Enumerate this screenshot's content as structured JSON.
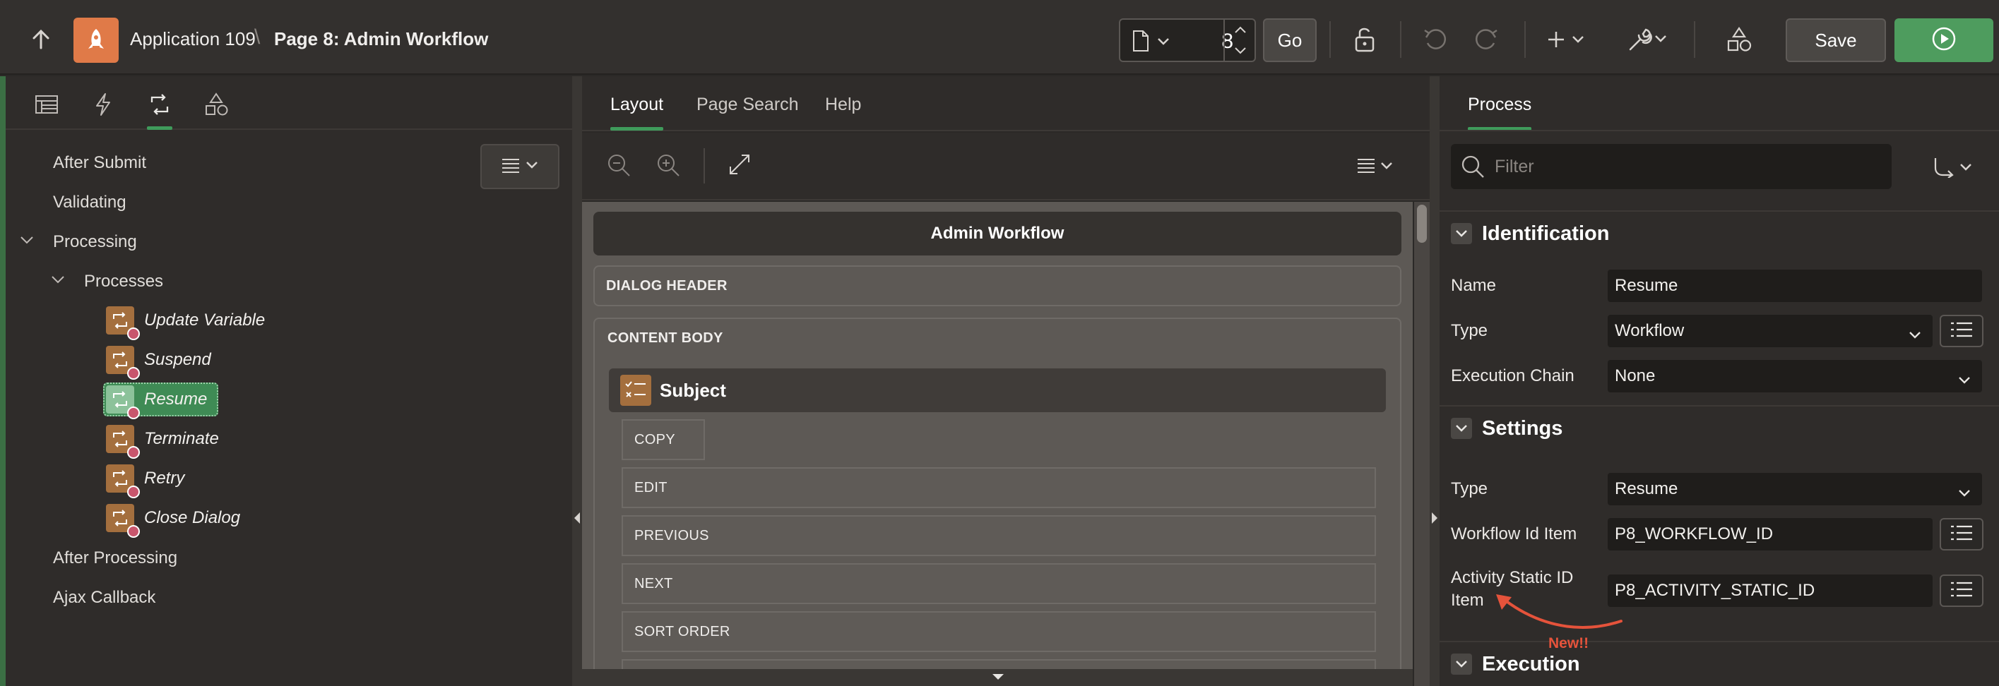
{
  "header": {
    "app_name": "Application 109",
    "separator": "\\",
    "page_title": "Page 8: Admin Workflow",
    "page_number": "8",
    "go_label": "Go",
    "save_label": "Save"
  },
  "left_panel": {
    "tree": {
      "after_submit": "After Submit",
      "validating": "Validating",
      "processing": "Processing",
      "processes": "Processes",
      "items": [
        {
          "label": "Update Variable"
        },
        {
          "label": "Suspend"
        },
        {
          "label": "Resume"
        },
        {
          "label": "Terminate"
        },
        {
          "label": "Retry"
        },
        {
          "label": "Close Dialog"
        }
      ],
      "after_processing": "After Processing",
      "ajax_callback": "Ajax Callback"
    }
  },
  "center_panel": {
    "tabs": [
      "Layout",
      "Page Search",
      "Help"
    ],
    "page_region_title": "Admin Workflow",
    "dialog_header": "DIALOG HEADER",
    "content_body": "CONTENT BODY",
    "subject_region": "Subject",
    "buttons": [
      "COPY",
      "EDIT",
      "PREVIOUS",
      "NEXT",
      "SORT ORDER"
    ]
  },
  "right_panel": {
    "tab": "Process",
    "filter_placeholder": "Filter",
    "identification": {
      "title": "Identification",
      "name_label": "Name",
      "name_value": "Resume",
      "type_label": "Type",
      "type_value": "Workflow",
      "chain_label": "Execution Chain",
      "chain_value": "None"
    },
    "settings": {
      "title": "Settings",
      "type_label": "Type",
      "type_value": "Resume",
      "workflow_id_label": "Workflow Id Item",
      "workflow_id_value": "P8_WORKFLOW_ID",
      "activity_label_line1": "Activity Static ID",
      "activity_label_line2": "Item",
      "activity_value": "P8_ACTIVITY_STATIC_ID"
    },
    "execution": {
      "title": "Execution"
    }
  },
  "annotation": {
    "text": "New!!",
    "color": "#e5533b"
  },
  "colors": {
    "accent_green": "#3f9b5b",
    "run_button": "#4e9c5e",
    "app_icon": "#e07a48",
    "process_icon": "#a46f3e"
  },
  "icons": [
    "up-arrow-icon",
    "rocket-icon",
    "page-icon",
    "undo-icon",
    "redo-icon",
    "plus-icon",
    "wrench-icon",
    "shapes-icon",
    "run-icon",
    "zoom-out-icon",
    "zoom-in-icon",
    "expand-icon",
    "menu-icon",
    "search-icon",
    "dependency-icon"
  ]
}
